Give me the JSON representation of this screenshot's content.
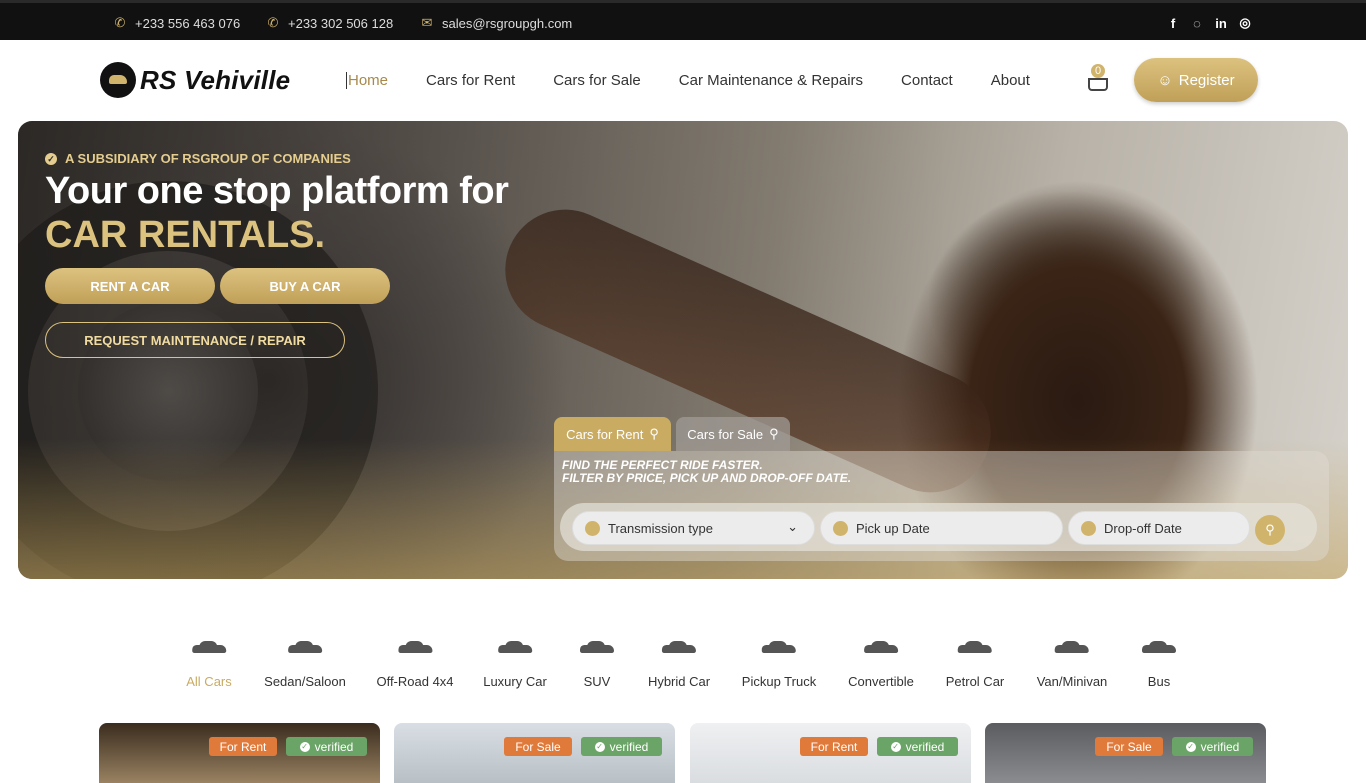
{
  "topbar": {
    "phone1": "+233 556 463 076",
    "phone2": "+233 302 506 128",
    "email": "sales@rsgroupgh.com",
    "social": [
      "facebook-icon",
      "whatsapp-icon",
      "linkedin-icon",
      "instagram-icon"
    ]
  },
  "header": {
    "brand": "RS Vehiville",
    "nav": [
      "Home",
      "Cars for Rent",
      "Cars for Sale",
      "Car Maintenance & Repairs",
      "Contact",
      "About"
    ],
    "cart_count": "0",
    "register_label": "Register"
  },
  "hero": {
    "eyebrow": "A SUBSIDIARY OF RSGROUP OF COMPANIES",
    "title_line1": "Your one stop platform for",
    "title_line2": "CAR RENTALS.",
    "rent_button": "RENT A CAR",
    "buy_button": "BUY A CAR",
    "maintenance_button": "REQUEST MAINTENANCE / REPAIR"
  },
  "search": {
    "tabs": [
      "Cars for Rent",
      "Cars for Sale"
    ],
    "active_tab": "Cars for Rent",
    "hint_line1": "FIND THE PERFECT RIDE FASTER.",
    "hint_line2": "FILTER BY PRICE, PICK UP AND DROP-OFF DATE.",
    "transmission_placeholder": "Transmission type",
    "pickup_placeholder": "Pick up Date",
    "dropoff_placeholder": "Drop-off Date"
  },
  "categories": [
    "All Cars",
    "Sedan/Saloon",
    "Off-Road 4x4",
    "Luxury Car",
    "SUV",
    "Hybrid Car",
    "Pickup Truck",
    "Convertible",
    "Petrol Car",
    "Van/Minivan",
    "Bus"
  ],
  "active_category": "All Cars",
  "listings": [
    {
      "type": "For Rent",
      "status": "verified"
    },
    {
      "type": "For Sale",
      "status": "verified"
    },
    {
      "type": "For Rent",
      "status": "verified"
    },
    {
      "type": "For Sale",
      "status": "verified"
    }
  ],
  "colors": {
    "accent": "#d1b46c",
    "dark": "#111111",
    "for_rent": "#e07a3a",
    "verified": "#6aa466"
  }
}
